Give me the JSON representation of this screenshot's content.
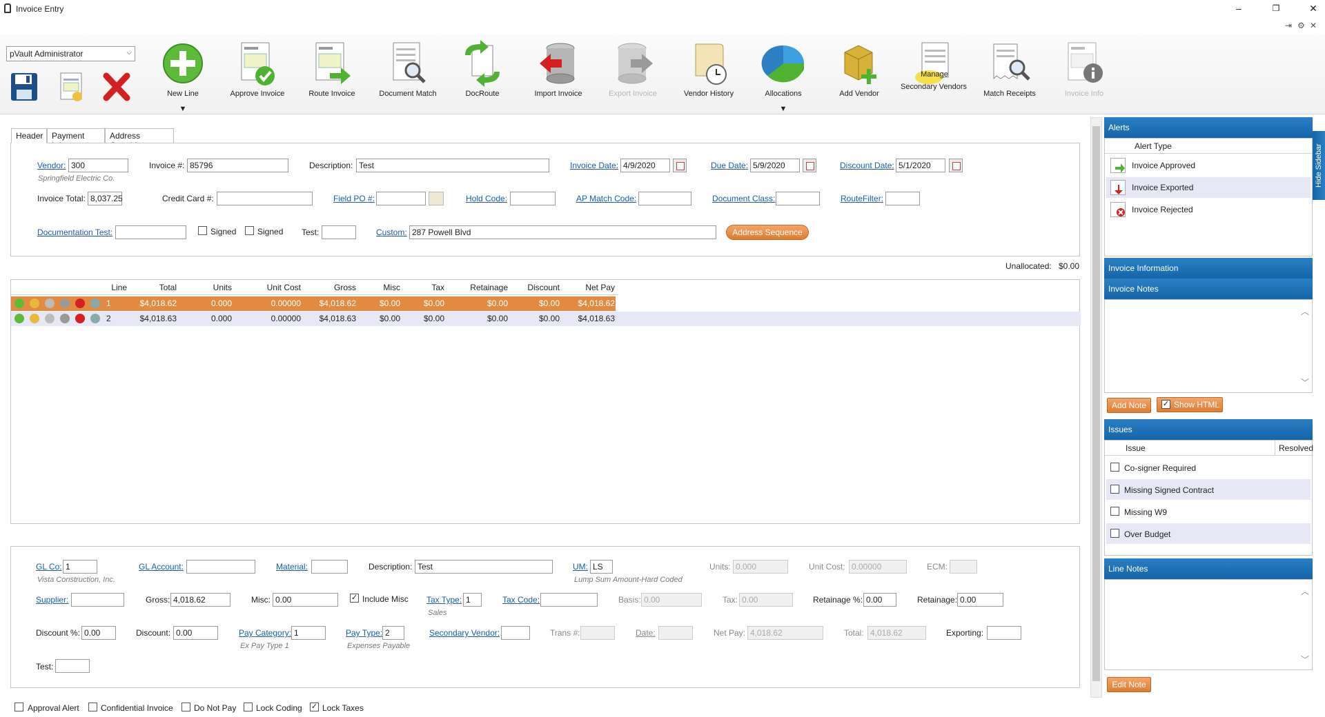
{
  "window": {
    "title": "Invoice Entry",
    "minimize": "–",
    "restore": "❐",
    "close": "✕"
  },
  "toolbar": {
    "user": "pVault Administrator",
    "buttons": [
      {
        "label": "New Line",
        "icon": "plus-icon",
        "dropdown": "▼"
      },
      {
        "label": "Approve Invoice",
        "icon": "approve-invoice-icon"
      },
      {
        "label": "Route Invoice",
        "icon": "route-invoice-icon"
      },
      {
        "label": "Document Match",
        "icon": "document-match-icon"
      },
      {
        "label": "DocRoute",
        "icon": "docroute-icon"
      },
      {
        "label": "Import Invoice",
        "icon": "import-invoice-icon"
      },
      {
        "label": "Export Invoice",
        "icon": "export-invoice-icon"
      },
      {
        "label": "Vendor History",
        "icon": "vendor-history-icon"
      },
      {
        "label": "Allocations",
        "icon": "allocations-icon",
        "dropdown": "▼"
      },
      {
        "label": "Add Vendor",
        "icon": "add-vendor-icon"
      },
      {
        "label": "Secondary Vendors",
        "icon": "secondary-vendors-icon",
        "overlay": "Manage"
      },
      {
        "label": "Match Receipts",
        "icon": "match-receipts-icon"
      },
      {
        "label": "Invoice Info",
        "icon": "invoice-info-icon"
      }
    ]
  },
  "tabs": [
    "Header",
    "Payment Info",
    "Address Override"
  ],
  "header": {
    "vendor_label": "Vendor:",
    "vendor": "300",
    "vendor_name": "Springfield Electric Co.",
    "invoice_no_label": "Invoice #:",
    "invoice_no": "85796",
    "description_label": "Description:",
    "description": "Test",
    "invoice_date_label": "Invoice Date:",
    "invoice_date": "4/9/2020",
    "due_date_label": "Due Date:",
    "due_date": "5/9/2020",
    "discount_date_label": "Discount Date:",
    "discount_date": "5/1/2020",
    "invoice_total_label": "Invoice Total:",
    "invoice_total": "8,037.25",
    "credit_card_label": "Credit Card #:",
    "credit_card": "",
    "field_po_label": "Field PO #:",
    "field_po": "",
    "hold_code_label": "Hold Code:",
    "hold_code": "",
    "ap_match_label": "AP Match Code:",
    "ap_match": "",
    "doc_class_label": "Document Class:",
    "doc_class": "",
    "route_filter_label": "RouteFilter:",
    "route_filter": "",
    "doc_test_label": "Documentation Test:",
    "doc_test": "",
    "signed1_label": "Signed",
    "signed2_label": "Signed",
    "test_label": "Test:",
    "test": "",
    "custom_label": "Custom:",
    "custom": "287 Powell Blvd",
    "address_sequence": "Address Sequence"
  },
  "unallocated": {
    "label": "Unallocated:",
    "value": "$0.00"
  },
  "lines": {
    "columns": [
      "Line",
      "Total",
      "Units",
      "Unit Cost",
      "Gross",
      "Misc",
      "Tax",
      "Retainage",
      "Discount",
      "Net Pay"
    ],
    "rows": [
      [
        "1",
        "$4,018.62",
        "0.000",
        "0.00000",
        "$4,018.62",
        "$0.00",
        "$0.00",
        "$0.00",
        "$0.00",
        "$4,018.62"
      ],
      [
        "2",
        "$4,018.63",
        "0.000",
        "0.00000",
        "$4,018.63",
        "$0.00",
        "$0.00",
        "$0.00",
        "$0.00",
        "$4,018.63"
      ]
    ]
  },
  "detail": {
    "gl_co_label": "GL Co:",
    "gl_co": "1",
    "gl_co_name": "Vista Construction, Inc.",
    "gl_account_label": "GL Account:",
    "gl_account": "",
    "material_label": "Material:",
    "material": "",
    "description_label": "Description:",
    "description": "Test",
    "um_label": "UM:",
    "um": "LS",
    "um_desc": "Lump Sum Amount-Hard Coded",
    "units_label": "Units:",
    "units": "0.000",
    "unit_cost_label": "Unit Cost:",
    "unit_cost": "0.00000",
    "ecm_label": "ECM:",
    "supplier_label": "Supplier:",
    "supplier": "",
    "gross_label": "Gross:",
    "gross": "4,018.62",
    "misc_label": "Misc:",
    "misc": "0.00",
    "include_misc_label": "Include Misc",
    "tax_type_label": "Tax Type:",
    "tax_type": "1",
    "tax_type_desc": "Sales",
    "tax_code_label": "Tax Code:",
    "tax_code": "",
    "basis_label": "Basis:",
    "basis": "0.00",
    "tax_label": "Tax:",
    "tax": "0.00",
    "retainage_pct_label": "Retainage %:",
    "retainage_pct": "0.00",
    "retainage_label": "Retainage:",
    "retainage": "0.00",
    "discount_pct_label": "Discount %:",
    "discount_pct": "0.00",
    "discount_label": "Discount:",
    "discount": "0.00",
    "pay_category_label": "Pay Category:",
    "pay_category": "1",
    "pay_category_desc": "Ex Pay Type 1",
    "pay_type_label": "Pay Type:",
    "pay_type": "2",
    "pay_type_desc": "Expenses Payable",
    "secondary_vendor_label": "Secondary Vendor:",
    "secondary_vendor": "",
    "trans_label": "Trans #:",
    "trans": "",
    "date_label": "Date:",
    "date": "",
    "net_pay_label": "Net Pay:",
    "net_pay": "4,018.62",
    "total_label": "Total:",
    "total": "4,018.62",
    "exporting_label": "Exporting:",
    "exporting": "",
    "test_label": "Test:",
    "test": ""
  },
  "status": {
    "approval_alert": "Approval Alert",
    "confidential": "Confidential Invoice",
    "do_not_pay": "Do Not Pay",
    "lock_coding": "Lock Coding",
    "lock_taxes": "Lock Taxes"
  },
  "sidebar": {
    "hide_label": "Hide Sidebar",
    "alerts_title": "Alerts",
    "alert_col": "Alert Type",
    "alerts": [
      "Invoice Approved",
      "Invoice Exported",
      "Invoice Rejected"
    ],
    "invoice_info_title": "Invoice Information",
    "invoice_notes_title": "Invoice Notes",
    "add_note": "Add Note",
    "show_html": "Show HTML",
    "issues_title": "Issues",
    "issue_col": "Issue",
    "resolved_col": "Resolved",
    "issues": [
      "Co-signer Required",
      "Missing Signed Contract",
      "Missing W9",
      "Over Budget"
    ],
    "line_notes_title": "Line Notes",
    "edit_note": "Edit Note"
  },
  "colors": {
    "accent": "#1565a8",
    "selected_row": "#e38a42",
    "alt_row": "#e7e8f6",
    "orange_button": "#e07c2e"
  }
}
